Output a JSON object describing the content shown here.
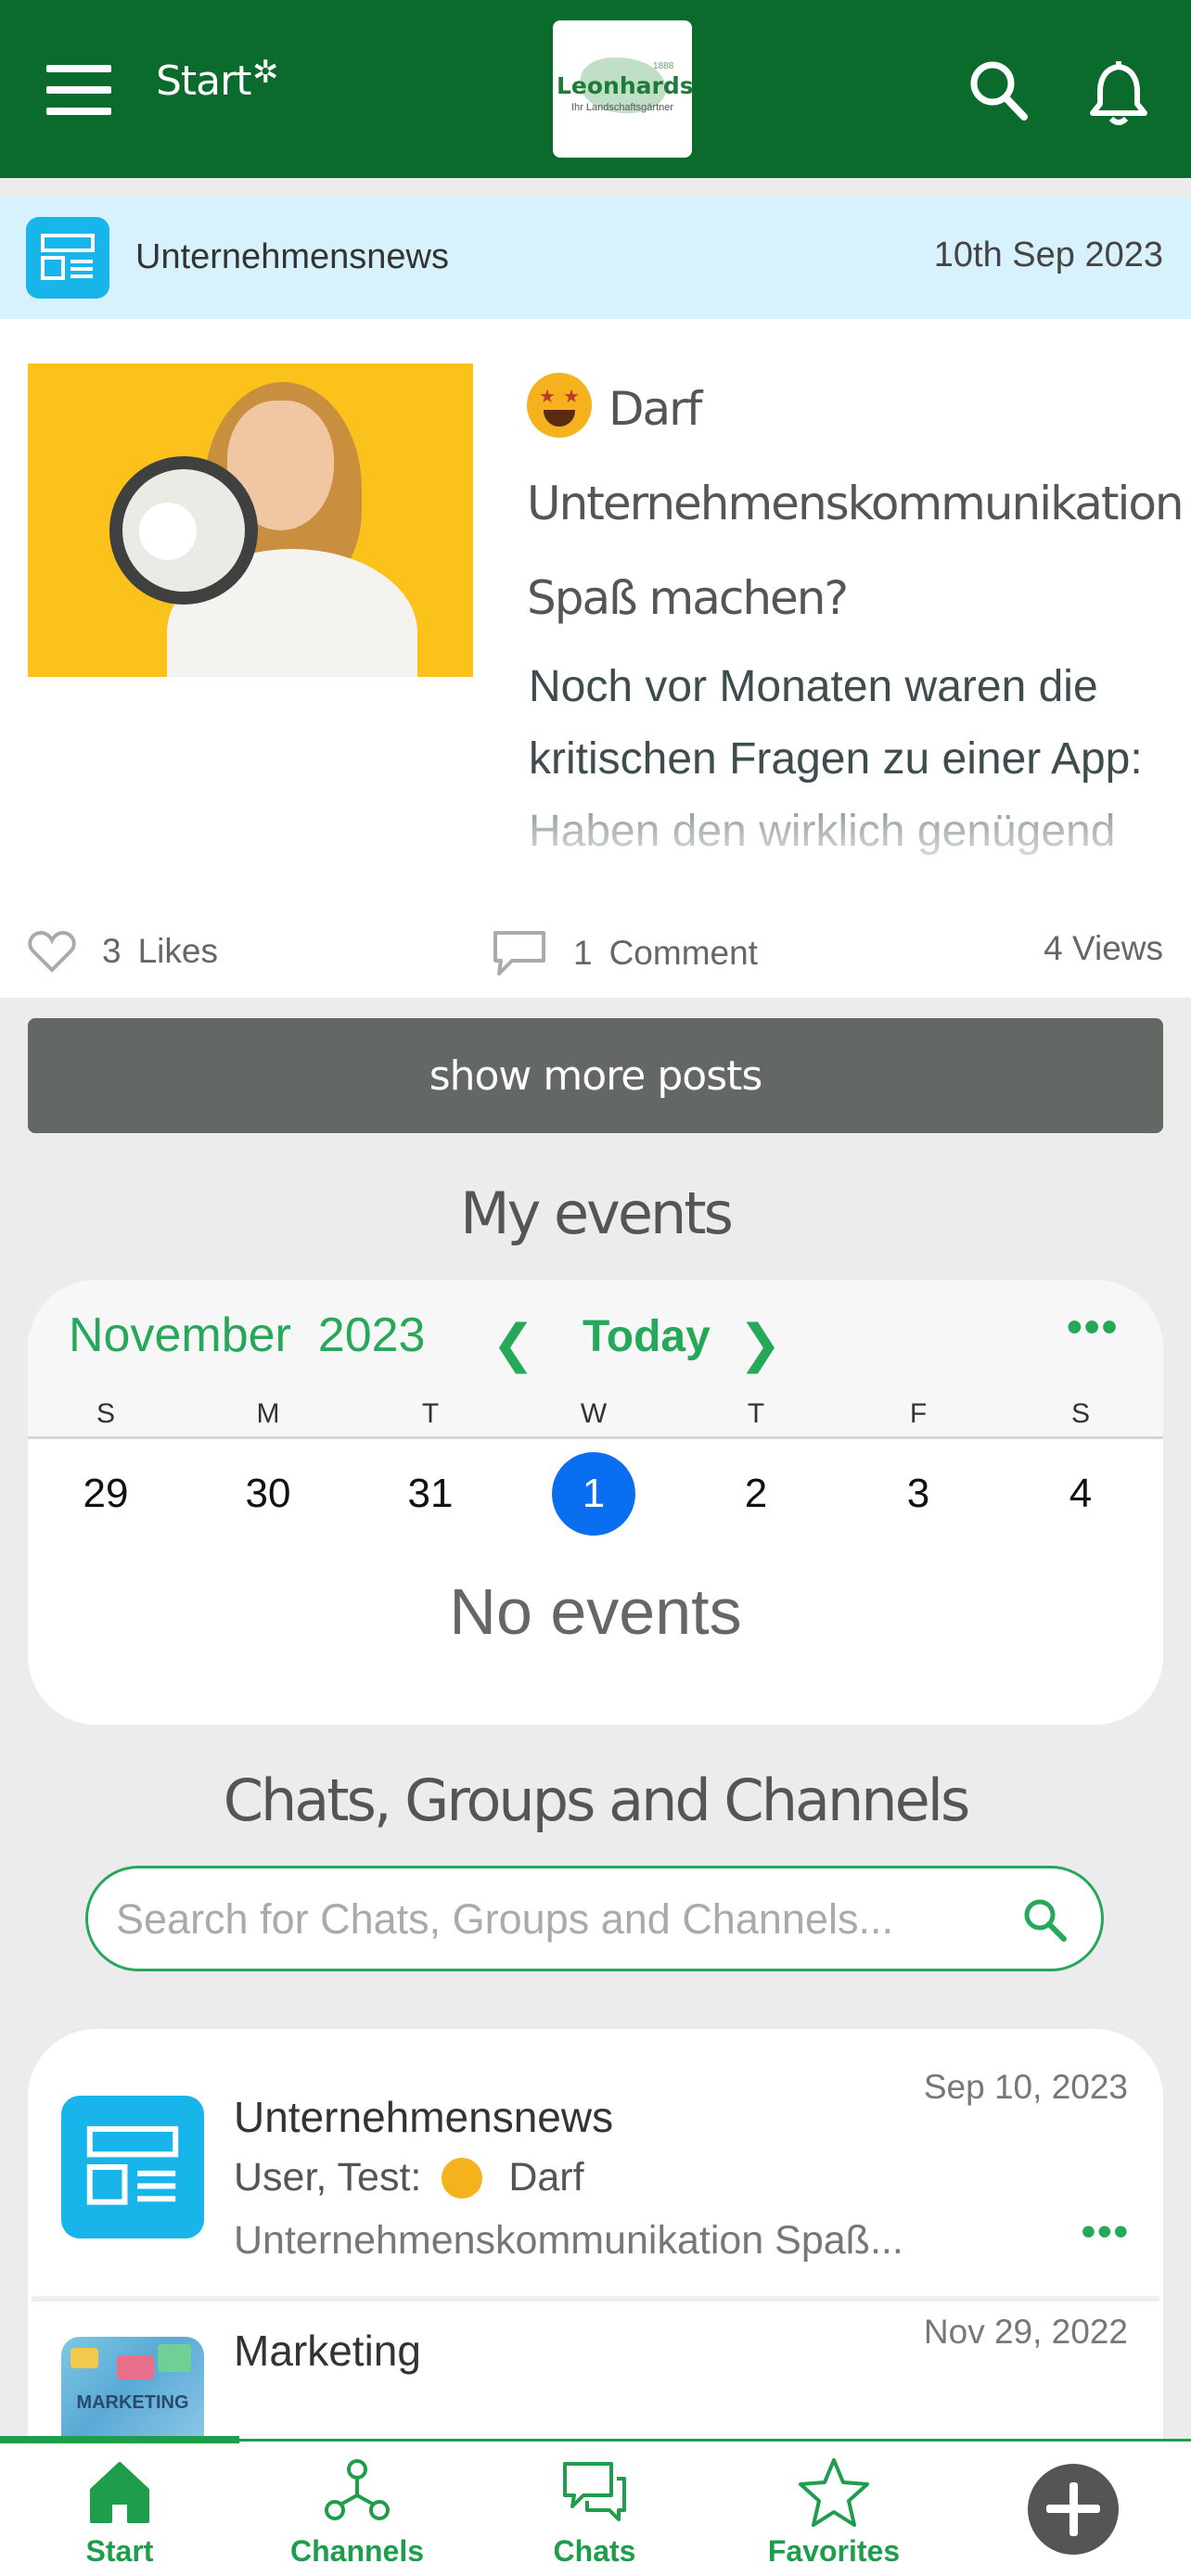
{
  "header": {
    "title": "Start",
    "logo_text": "Leonhards",
    "logo_subtitle": "Ihr Landschaftsgärtner",
    "logo_small": "1888"
  },
  "news": {
    "channel_name": "Unternehmensnews",
    "date": "10th Sep 2023",
    "title": "Darf Unternehmenskommunikation Spaß machen?",
    "excerpt": "Noch vor Monaten waren die kritischen Fragen zu einer App: Haben den wirklich genügend Mitarbeitende ein",
    "likes_count": "3",
    "likes_label": "Likes",
    "comments_count": "1",
    "comments_label": "Comment",
    "views": "4 Views"
  },
  "show_more_label": "show more posts",
  "events": {
    "section_title": "My events",
    "month": "November",
    "year": "2023",
    "today_label": "Today",
    "weekdays": [
      "S",
      "M",
      "T",
      "W",
      "T",
      "F",
      "S"
    ],
    "days": [
      "29",
      "30",
      "31",
      "1",
      "2",
      "3",
      "4"
    ],
    "selected_day": "1",
    "empty_text": "No events"
  },
  "chats": {
    "section_title": "Chats, Groups and Channels",
    "search_placeholder": "Search for Chats, Groups and Channels...",
    "items": [
      {
        "name": "Unternehmensnews",
        "date": "Sep 10, 2023",
        "sender": "User, Test:",
        "message_line1": "Darf",
        "message_line2": "Unternehmenskommunikation Spaß..."
      },
      {
        "name": "Marketing",
        "date": "Nov 29, 2022",
        "avatar_text": "MARKETING"
      }
    ]
  },
  "nav": {
    "items": [
      {
        "label": "Start"
      },
      {
        "label": "Channels"
      },
      {
        "label": "Chats"
      },
      {
        "label": "Favorites"
      }
    ]
  },
  "colors": {
    "header_green": "#0b6b2c",
    "accent_green": "#25a85a",
    "news_blue": "#18b5ea",
    "selected_day_blue": "#0a6ef0"
  }
}
